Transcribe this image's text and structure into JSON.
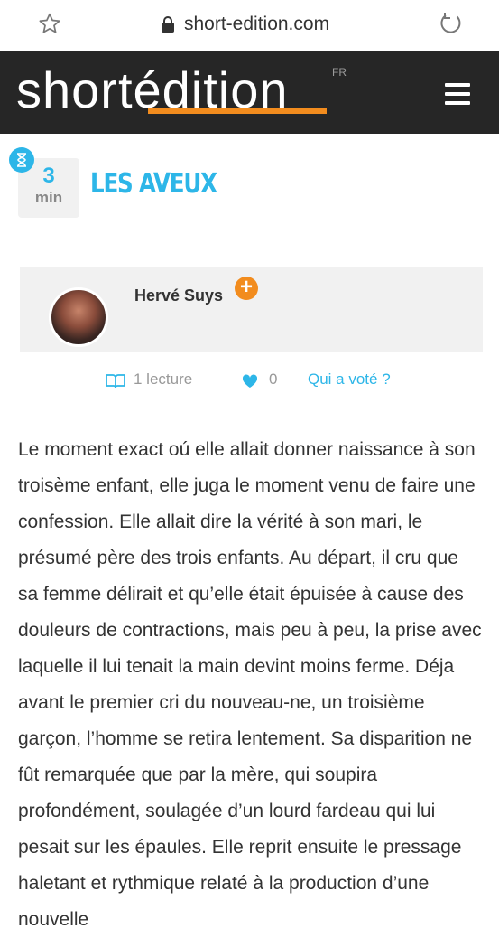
{
  "browser": {
    "url": "short-edition.com"
  },
  "header": {
    "logo": "shortédition",
    "lang": "FR"
  },
  "story": {
    "reading_time_value": "3",
    "reading_time_unit": "min",
    "title": "LES AVEUX",
    "author": "Hervé Suys",
    "follow_symbol": "+",
    "reads": "1 lecture",
    "likes": "0",
    "voters_link": "Qui a voté ?",
    "text": "Le moment exact oú elle allait donner naissance à son troisème enfant, elle juga le moment venu de faire une confession. Elle allait dire la vérité à son mari, le présumé père des trois enfants. Au départ, il cru que sa femme délirait et qu’elle était épuisée à cause des douleurs de contractions, mais peu à peu, la prise avec laquelle il lui tenait la main devint moins ferme. Déja avant le premier cri du nouveau-ne, un troisième garçon, l’homme se retira lentement. Sa disparition ne fût remarquée que par la mère, qui soupira profondément, soulagée d’un lourd fardeau qui lui pesait sur les épaules. Elle reprit ensuite le pressage haletant et rythmique relaté à la production d’une nouvelle"
  },
  "colors": {
    "accent_blue": "#2db6e8",
    "accent_orange": "#f28c1e",
    "header_bg": "#262626"
  },
  "icons": [
    "star-icon",
    "lock-icon",
    "reload-icon",
    "menu-icon",
    "hourglass-icon",
    "book-icon",
    "heart-icon",
    "plus-icon"
  ]
}
